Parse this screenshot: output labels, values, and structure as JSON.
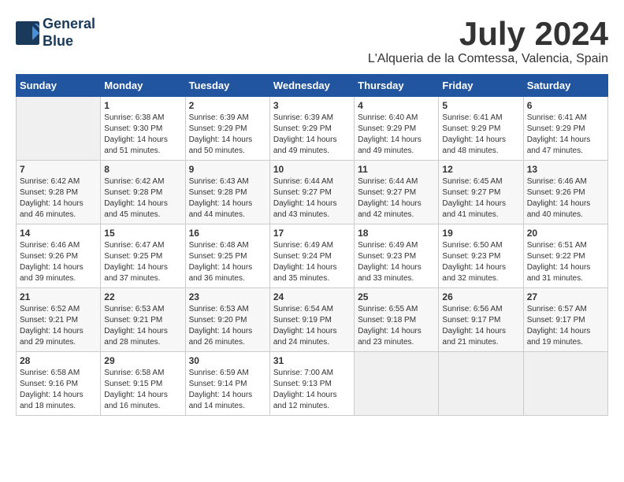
{
  "logo": {
    "line1": "General",
    "line2": "Blue"
  },
  "title": "July 2024",
  "location": "L'Alqueria de la Comtessa, Valencia, Spain",
  "weekdays": [
    "Sunday",
    "Monday",
    "Tuesday",
    "Wednesday",
    "Thursday",
    "Friday",
    "Saturday"
  ],
  "weeks": [
    [
      null,
      {
        "day": "1",
        "sunrise": "6:38 AM",
        "sunset": "9:30 PM",
        "daylight": "14 hours and 51 minutes."
      },
      {
        "day": "2",
        "sunrise": "6:39 AM",
        "sunset": "9:29 PM",
        "daylight": "14 hours and 50 minutes."
      },
      {
        "day": "3",
        "sunrise": "6:39 AM",
        "sunset": "9:29 PM",
        "daylight": "14 hours and 49 minutes."
      },
      {
        "day": "4",
        "sunrise": "6:40 AM",
        "sunset": "9:29 PM",
        "daylight": "14 hours and 49 minutes."
      },
      {
        "day": "5",
        "sunrise": "6:41 AM",
        "sunset": "9:29 PM",
        "daylight": "14 hours and 48 minutes."
      },
      {
        "day": "6",
        "sunrise": "6:41 AM",
        "sunset": "9:29 PM",
        "daylight": "14 hours and 47 minutes."
      }
    ],
    [
      {
        "day": "7",
        "sunrise": "6:42 AM",
        "sunset": "9:28 PM",
        "daylight": "14 hours and 46 minutes."
      },
      {
        "day": "8",
        "sunrise": "6:42 AM",
        "sunset": "9:28 PM",
        "daylight": "14 hours and 45 minutes."
      },
      {
        "day": "9",
        "sunrise": "6:43 AM",
        "sunset": "9:28 PM",
        "daylight": "14 hours and 44 minutes."
      },
      {
        "day": "10",
        "sunrise": "6:44 AM",
        "sunset": "9:27 PM",
        "daylight": "14 hours and 43 minutes."
      },
      {
        "day": "11",
        "sunrise": "6:44 AM",
        "sunset": "9:27 PM",
        "daylight": "14 hours and 42 minutes."
      },
      {
        "day": "12",
        "sunrise": "6:45 AM",
        "sunset": "9:27 PM",
        "daylight": "14 hours and 41 minutes."
      },
      {
        "day": "13",
        "sunrise": "6:46 AM",
        "sunset": "9:26 PM",
        "daylight": "14 hours and 40 minutes."
      }
    ],
    [
      {
        "day": "14",
        "sunrise": "6:46 AM",
        "sunset": "9:26 PM",
        "daylight": "14 hours and 39 minutes."
      },
      {
        "day": "15",
        "sunrise": "6:47 AM",
        "sunset": "9:25 PM",
        "daylight": "14 hours and 37 minutes."
      },
      {
        "day": "16",
        "sunrise": "6:48 AM",
        "sunset": "9:25 PM",
        "daylight": "14 hours and 36 minutes."
      },
      {
        "day": "17",
        "sunrise": "6:49 AM",
        "sunset": "9:24 PM",
        "daylight": "14 hours and 35 minutes."
      },
      {
        "day": "18",
        "sunrise": "6:49 AM",
        "sunset": "9:23 PM",
        "daylight": "14 hours and 33 minutes."
      },
      {
        "day": "19",
        "sunrise": "6:50 AM",
        "sunset": "9:23 PM",
        "daylight": "14 hours and 32 minutes."
      },
      {
        "day": "20",
        "sunrise": "6:51 AM",
        "sunset": "9:22 PM",
        "daylight": "14 hours and 31 minutes."
      }
    ],
    [
      {
        "day": "21",
        "sunrise": "6:52 AM",
        "sunset": "9:21 PM",
        "daylight": "14 hours and 29 minutes."
      },
      {
        "day": "22",
        "sunrise": "6:53 AM",
        "sunset": "9:21 PM",
        "daylight": "14 hours and 28 minutes."
      },
      {
        "day": "23",
        "sunrise": "6:53 AM",
        "sunset": "9:20 PM",
        "daylight": "14 hours and 26 minutes."
      },
      {
        "day": "24",
        "sunrise": "6:54 AM",
        "sunset": "9:19 PM",
        "daylight": "14 hours and 24 minutes."
      },
      {
        "day": "25",
        "sunrise": "6:55 AM",
        "sunset": "9:18 PM",
        "daylight": "14 hours and 23 minutes."
      },
      {
        "day": "26",
        "sunrise": "6:56 AM",
        "sunset": "9:17 PM",
        "daylight": "14 hours and 21 minutes."
      },
      {
        "day": "27",
        "sunrise": "6:57 AM",
        "sunset": "9:17 PM",
        "daylight": "14 hours and 19 minutes."
      }
    ],
    [
      {
        "day": "28",
        "sunrise": "6:58 AM",
        "sunset": "9:16 PM",
        "daylight": "14 hours and 18 minutes."
      },
      {
        "day": "29",
        "sunrise": "6:58 AM",
        "sunset": "9:15 PM",
        "daylight": "14 hours and 16 minutes."
      },
      {
        "day": "30",
        "sunrise": "6:59 AM",
        "sunset": "9:14 PM",
        "daylight": "14 hours and 14 minutes."
      },
      {
        "day": "31",
        "sunrise": "7:00 AM",
        "sunset": "9:13 PM",
        "daylight": "14 hours and 12 minutes."
      },
      null,
      null,
      null
    ]
  ],
  "labels": {
    "sunrise_prefix": "Sunrise: ",
    "sunset_prefix": "Sunset: ",
    "daylight_prefix": "Daylight: "
  }
}
